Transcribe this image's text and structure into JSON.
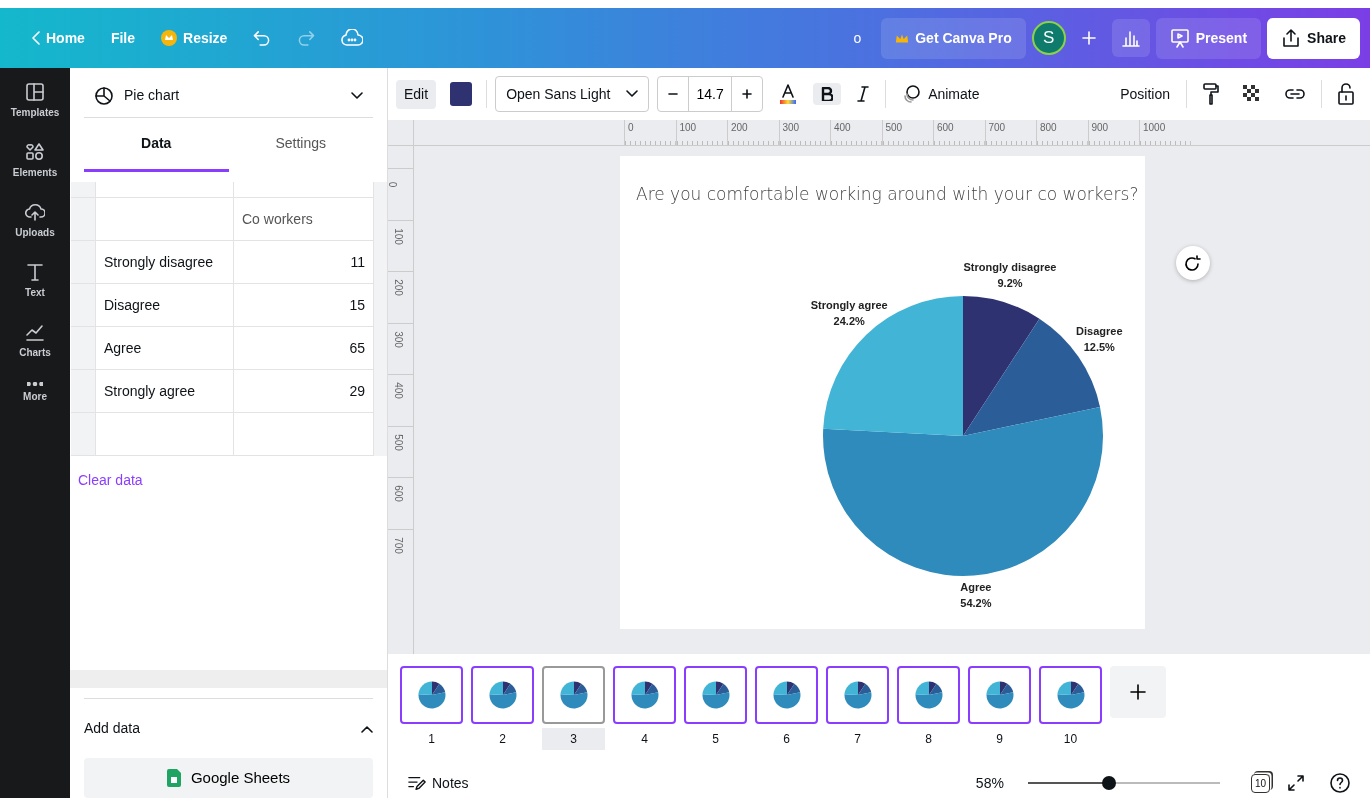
{
  "topbar": {
    "home": "Home",
    "file": "File",
    "resize": "Resize",
    "status": "o",
    "get_pro": "Get Canva Pro",
    "avatar": "S",
    "present": "Present",
    "share": "Share"
  },
  "rail": [
    {
      "label": "Templates",
      "kind": "templates"
    },
    {
      "label": "Elements",
      "kind": "elements"
    },
    {
      "label": "Uploads",
      "kind": "uploads"
    },
    {
      "label": "Text",
      "kind": "text"
    },
    {
      "label": "Charts",
      "kind": "charts"
    },
    {
      "label": "More",
      "kind": "more"
    }
  ],
  "panel": {
    "chart_type": "Pie chart",
    "tabs": [
      {
        "label": "Data",
        "selected": true
      },
      {
        "label": "Settings",
        "selected": false
      }
    ],
    "series_header": "Co workers",
    "rows": [
      {
        "label": "Strongly disagree",
        "value": "11"
      },
      {
        "label": "Disagree",
        "value": "15"
      },
      {
        "label": "Agree",
        "value": "65"
      },
      {
        "label": "Strongly agree",
        "value": "29"
      }
    ],
    "clear_data": "Clear data",
    "add_data": "Add data",
    "google_sheets": "Google Sheets"
  },
  "toolbar": {
    "edit": "Edit",
    "font": "Open Sans Light",
    "font_size": "14.7",
    "bold": true,
    "animate": "Animate",
    "position": "Position"
  },
  "ruler": {
    "horizontal": [
      "0",
      "100",
      "200",
      "300",
      "400",
      "500",
      "600",
      "700",
      "800",
      "900",
      "1000"
    ],
    "vertical": [
      "0",
      "100",
      "200",
      "300",
      "400",
      "500",
      "600",
      "700"
    ]
  },
  "slide": {
    "title": "Are you comfortable working around with your co workers?",
    "chart_data": {
      "type": "pie",
      "categories": [
        "Strongly disagree",
        "Disagree",
        "Agree",
        "Strongly agree"
      ],
      "series": [
        {
          "values": [
            9.2,
            12.5,
            54.2,
            24.2
          ]
        }
      ],
      "colors": [
        "#2e3270",
        "#2b5d98",
        "#2e8bbb",
        "#42b4d6"
      ],
      "value_labels": [
        "9.2%",
        "12.5%",
        "54.2%",
        "24.2%"
      ]
    }
  },
  "pages": [
    {
      "number": "1",
      "selected": false
    },
    {
      "number": "2",
      "selected": false
    },
    {
      "number": "3",
      "selected": true
    },
    {
      "number": "4",
      "selected": false
    },
    {
      "number": "5",
      "selected": false
    },
    {
      "number": "6",
      "selected": false
    },
    {
      "number": "7",
      "selected": false
    },
    {
      "number": "8",
      "selected": false
    },
    {
      "number": "9",
      "selected": false
    },
    {
      "number": "10",
      "selected": false
    }
  ],
  "footer": {
    "notes": "Notes",
    "zoom": "58%",
    "zoom_slider": {
      "level": 0.42
    },
    "page_count": "10"
  }
}
